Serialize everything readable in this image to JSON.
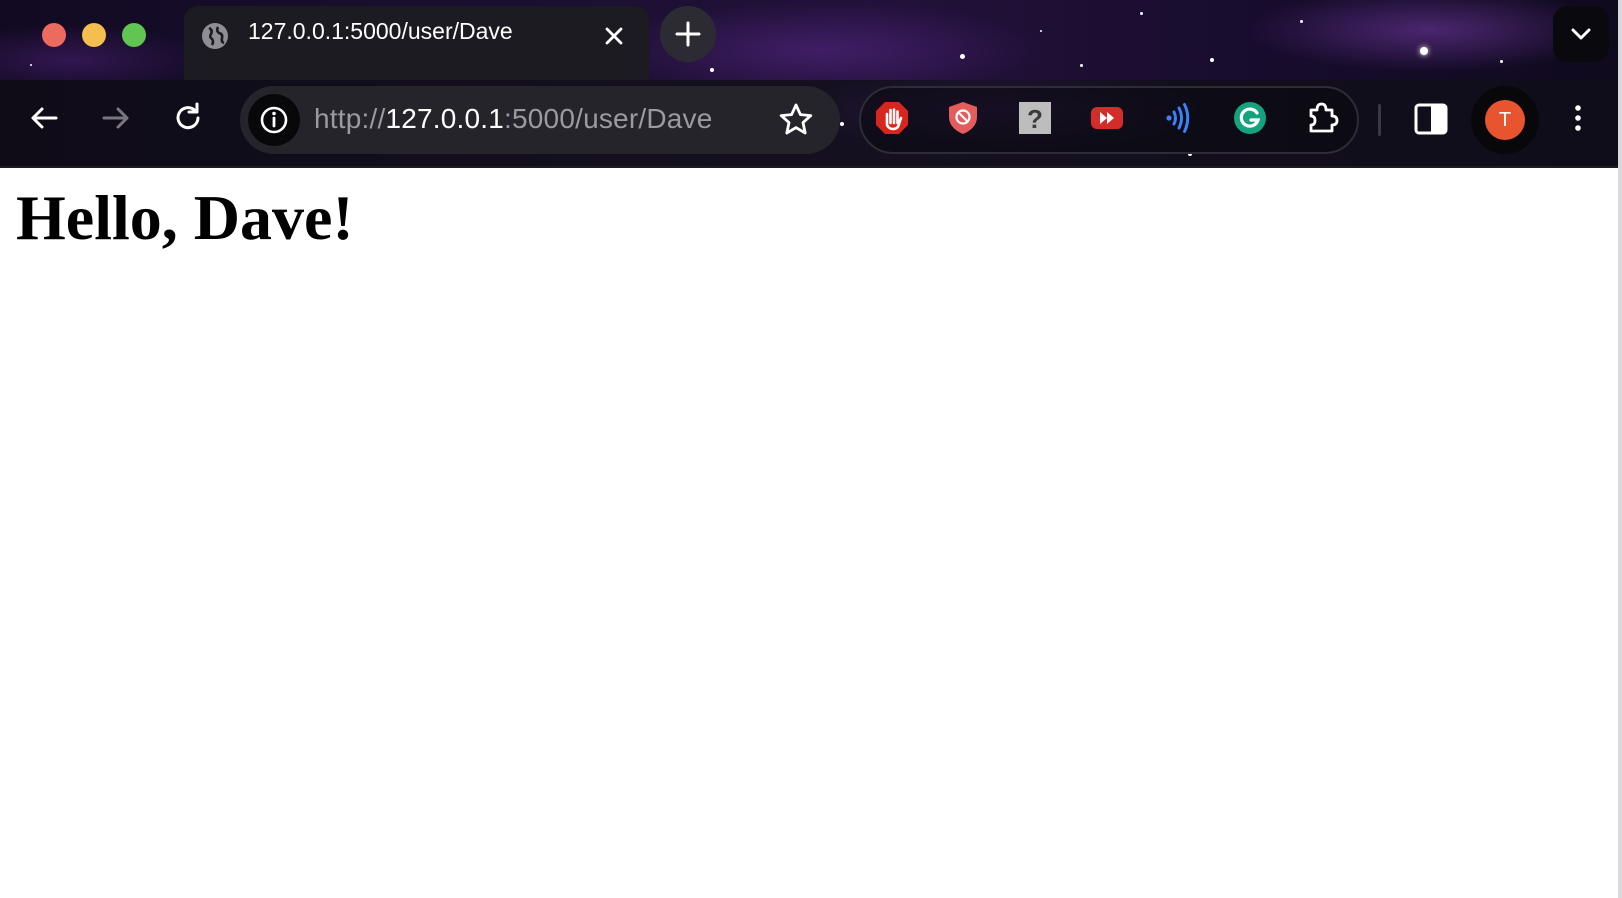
{
  "browser": {
    "tab": {
      "title": "127.0.0.1:5000/user/Dave",
      "favicon": "globe-icon"
    },
    "address_bar": {
      "scheme": "http://",
      "host": "127.0.0.1",
      "rest": ":5000/user/Dave"
    },
    "profile": {
      "initial": "T",
      "color": "#e8542e"
    },
    "extensions": [
      "adblock-hand-icon",
      "shield-block-icon",
      "question-mark-icon",
      "fast-forward-icon",
      "read-aloud-icon",
      "grammarly-icon",
      "extensions-puzzle-icon"
    ]
  },
  "page": {
    "heading": "Hello, Dave!"
  }
}
